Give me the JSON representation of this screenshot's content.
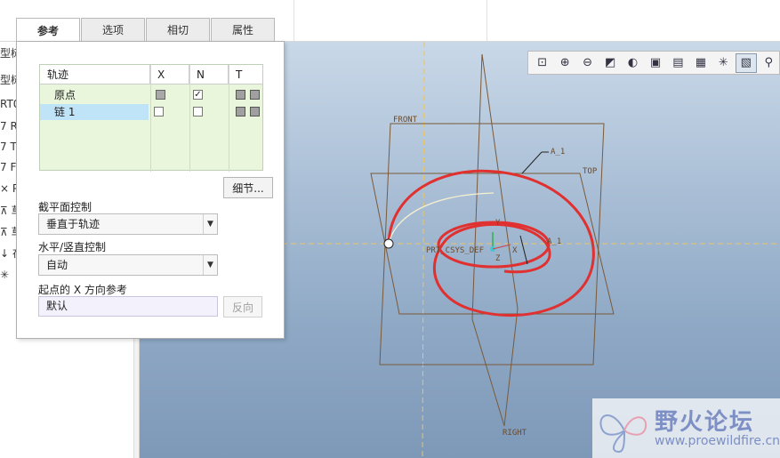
{
  "tabs": [
    {
      "label": "参考",
      "active": true
    },
    {
      "label": "选项",
      "active": false
    },
    {
      "label": "相切",
      "active": false
    },
    {
      "label": "属性",
      "active": false
    }
  ],
  "trajectory_table": {
    "headers": {
      "name": "轨迹",
      "x": "X",
      "n": "N",
      "t": "T"
    },
    "rows": [
      {
        "name": "原点",
        "x": "grey",
        "n": "checked"
      },
      {
        "name": "链 1",
        "x": "unchecked",
        "n": "unchecked"
      }
    ]
  },
  "details_button": "细节...",
  "section_plane": {
    "label": "截平面控制",
    "value": "垂直于轨迹"
  },
  "hv_control": {
    "label": "水平/竖直控制",
    "value": "自动"
  },
  "start_x_ref": {
    "label": "起点的 X 方向参考",
    "value": "默认",
    "button": "反向"
  },
  "left_tree_stubs": [
    "型树",
    "型树",
    "RT0",
    "7 R",
    "7 T(",
    "7 FI",
    "× PI",
    "⊼ 草",
    "⊼ 草",
    "↓ 在",
    "✳"
  ],
  "view_toolbar": [
    "zoom-fit-icon",
    "zoom-in-icon",
    "zoom-out-icon",
    "repaint-icon",
    "display-style-icon",
    "standard-orientation-icon",
    "saved-views-icon",
    "view-manager-icon",
    "datum-display-icon",
    "spin-center-icon",
    "annotation-display-icon"
  ],
  "cad_labels": {
    "front": "FRONT",
    "top": "TOP",
    "right": "RIGHT",
    "csys": "PRT_CSYS_DEF",
    "x_axis": "X",
    "z_axis": "Z",
    "y_axis": "Y",
    "a1": "A_1",
    "a1_small": "A_1"
  },
  "watermark": {
    "title": "野火论坛",
    "url": "www.proewildfire.cn"
  },
  "colors": {
    "spiral": "#e03030",
    "datum": "#7a5a3a",
    "viewport_top": "#c9d8e8",
    "viewport_bottom": "#7e99b8"
  }
}
